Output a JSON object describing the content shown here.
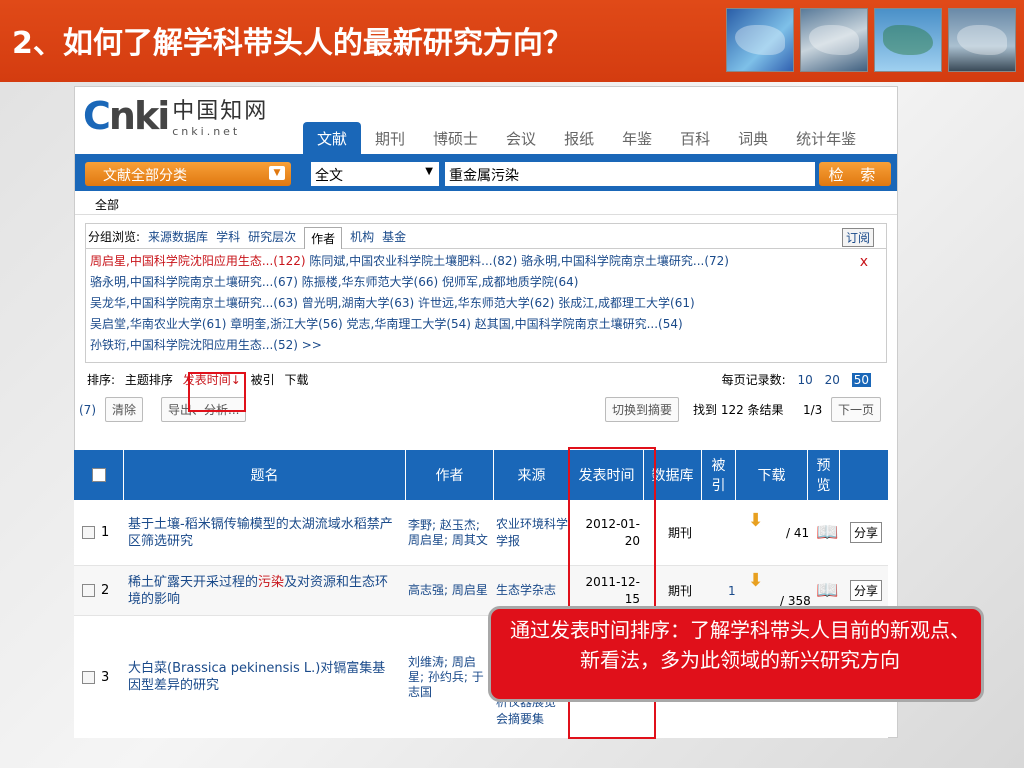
{
  "slide": {
    "title": "2、如何了解学科带头人的最新研究方向？",
    "callout": "通过发表时间排序：了解学科带头人目前的新观点、新看法，多为此领域的新兴研究方向"
  },
  "cnki": {
    "logo_cn": "中国知网",
    "logo_domain": "cnki.net",
    "nav_tabs": [
      "文献",
      "期刊",
      "博硕士",
      "会议",
      "报纸",
      "年鉴",
      "百科",
      "词典",
      "统计年鉴"
    ],
    "category_button": "文献全部分类",
    "field_select": "全文",
    "query": "重金属污染",
    "search_button": "检 索",
    "scope": "全部"
  },
  "group": {
    "label": "分组浏览:",
    "options": [
      "来源数据库",
      "学科",
      "研究层次",
      "作者",
      "机构",
      "基金"
    ],
    "subscribe": "订阅",
    "close": "x",
    "authors_line1_hl": "周启星,中国科学院沈阳应用生态...(122)",
    "authors_line1_rest": "陈同斌,中国农业科学院土壤肥料...(82)  骆永明,中国科学院南京土壤研究...(72)",
    "authors_line2": "骆永明,中国科学院南京土壤研究...(67)  陈振楼,华东师范大学(66)  倪师军,成都地质学院(64)",
    "authors_line3": "吴龙华,中国科学院南京土壤研究...(63)  曾光明,湖南大学(63)  许世远,华东师范大学(62)  张成江,成都理工大学(61)",
    "authors_line4": "吴启堂,华南农业大学(61)  章明奎,浙江大学(56)  党志,华南理工大学(54)  赵其国,中国科学院南京土壤研究...(54)",
    "authors_line5": "孙铁珩,中国科学院沈阳应用生态...(52)  >>"
  },
  "sort": {
    "label": "排序:",
    "topic": "主题排序",
    "date": "发表时间↓",
    "cited": "被引",
    "download": "下载",
    "per_page_label": "每页记录数:",
    "per_page_options": [
      "10",
      "20",
      "50"
    ]
  },
  "actions": {
    "count": "(7)",
    "clear": "清除",
    "export": "导出、分析...",
    "switch": "切换到摘要",
    "found": "找到 122 条结果",
    "page": "1/3",
    "next": "下一页"
  },
  "table": {
    "headers": [
      "题名",
      "作者",
      "来源",
      "发表时间",
      "数据库",
      "被引",
      "下载",
      "预览"
    ],
    "rows": [
      {
        "num": "1",
        "title": "基于土壤-稻米镉传输模型的太湖流域水稻禁产区筛选研究",
        "authors": "李野; 赵玉杰; 周启星; 周其文",
        "source": "农业环境科学学报",
        "date": "2012-01-20",
        "db": "期刊",
        "cited": "",
        "downloads": "41",
        "share": "分享"
      },
      {
        "num": "2",
        "title_pre": "稀土矿露天开采过程的",
        "title_hl": "污染",
        "title_post": "及对资源和生态环境的影响",
        "authors": "高志强; 周启星",
        "source": "生态学杂志",
        "date": "2011-12-15",
        "db": "期刊",
        "cited": "1",
        "downloads": "358",
        "share": "分享"
      },
      {
        "num": "3",
        "title": "大白菜(Brassica pekinensis L.)对镉富集基因型差异的研究",
        "authors": "刘维涛; 周启星; 孙约兵; 于志国",
        "source": "析仪器展览会摘要集",
        "date": "",
        "db": "",
        "cited": "",
        "downloads": "",
        "share": ""
      }
    ]
  },
  "colors": {
    "header_bg": "#d43c10",
    "cnki_blue": "#1a67b8",
    "highlight_red": "#c8141a",
    "annotation_red": "#e0101a"
  }
}
